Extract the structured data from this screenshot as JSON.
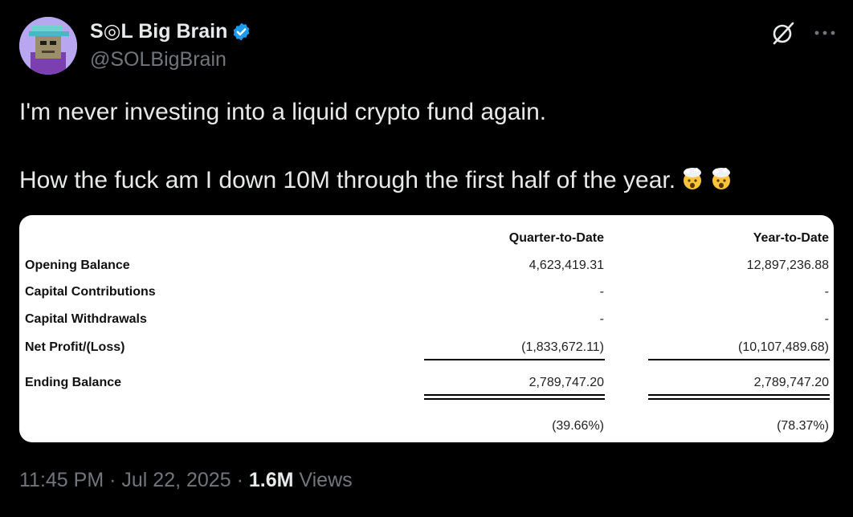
{
  "author": {
    "display_name": "S◎L Big Brain",
    "handle": "@SOLBigBrain",
    "verified": true,
    "verified_color": "#1d9bf0"
  },
  "tweet": {
    "line1": "I'm never investing into a liquid crypto fund again.",
    "line2": "How the fuck am I down 10M through the first half of the year.",
    "emojis": [
      "exploding-head-emoji",
      "exploding-head-emoji"
    ]
  },
  "statement": {
    "columns": [
      "Quarter-to-Date",
      "Year-to-Date"
    ],
    "rows": [
      {
        "label": "Opening Balance",
        "qtd": "4,623,419.31",
        "ytd": "12,897,236.88"
      },
      {
        "label": "Capital Contributions",
        "qtd": "-",
        "ytd": "-"
      },
      {
        "label": "Capital Withdrawals",
        "qtd": "-",
        "ytd": "-"
      },
      {
        "label": "Net Profit/(Loss)",
        "qtd": "(1,833,672.11)",
        "ytd": "(10,107,489.68)"
      },
      {
        "label": "Ending Balance",
        "qtd": "2,789,747.20",
        "ytd": "2,789,747.20"
      }
    ],
    "returns": {
      "qtd": "(39.66%)",
      "ytd": "(78.37%)"
    }
  },
  "meta": {
    "time": "11:45 PM",
    "separator": "·",
    "date": "Jul 22, 2025",
    "views_count": "1.6M",
    "views_label": "Views"
  },
  "icons": {
    "grok": "grok-icon",
    "more": "more-icon",
    "verified": "verified-badge-icon"
  },
  "colors": {
    "background": "#000000",
    "text": "#e7e9ea",
    "secondary": "#71767b",
    "accent": "#1d9bf0"
  }
}
